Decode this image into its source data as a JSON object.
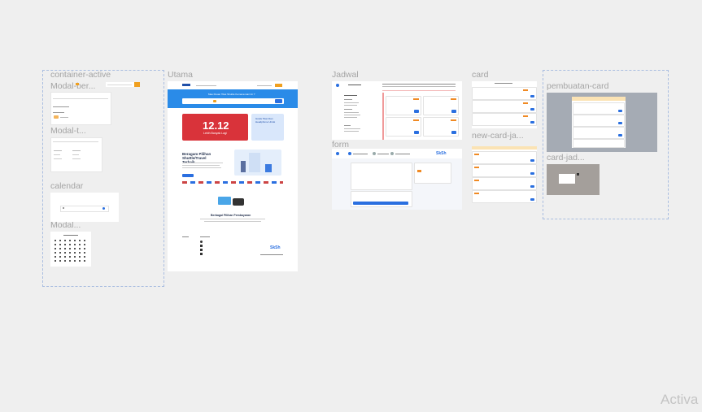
{
  "canvas": {
    "labels": {
      "container_active": "container-active",
      "modal_ber": "Modal-ber...",
      "modal_t": "Modal-t...",
      "calendar": "calendar",
      "modal": "Modal...",
      "utama": "Utama",
      "jadwal": "Jadwal",
      "form": "form",
      "card": "card",
      "new_card_ja": "new-card-ja...",
      "pembuatan_card": "pembuatan-card",
      "card_jad": "card-jad..."
    },
    "watermark": "Activa"
  },
  "utama": {
    "hero_question": "Mau Pesan Tiket Shuttle Kemana Hari Ini ?",
    "promo_number": "12.12",
    "promo_sub": "Lebih Banyak Lagi",
    "promo_side": "Gratis Tiket Dan Headphone Untuk",
    "section_title": "Beragam Pilihan Shuttle/Travel Terbaik",
    "payment_title": "Berbagai Pilihan Pembayaran",
    "brand": "SkSh"
  },
  "colors": {
    "canvas_bg": "#efefef",
    "primary_blue": "#2a8be8",
    "accent_orange": "#f08a24",
    "promo_red": "#d9333a",
    "overlay_gray": "#a5abb4",
    "card_jad_gray": "#a49f9b"
  }
}
